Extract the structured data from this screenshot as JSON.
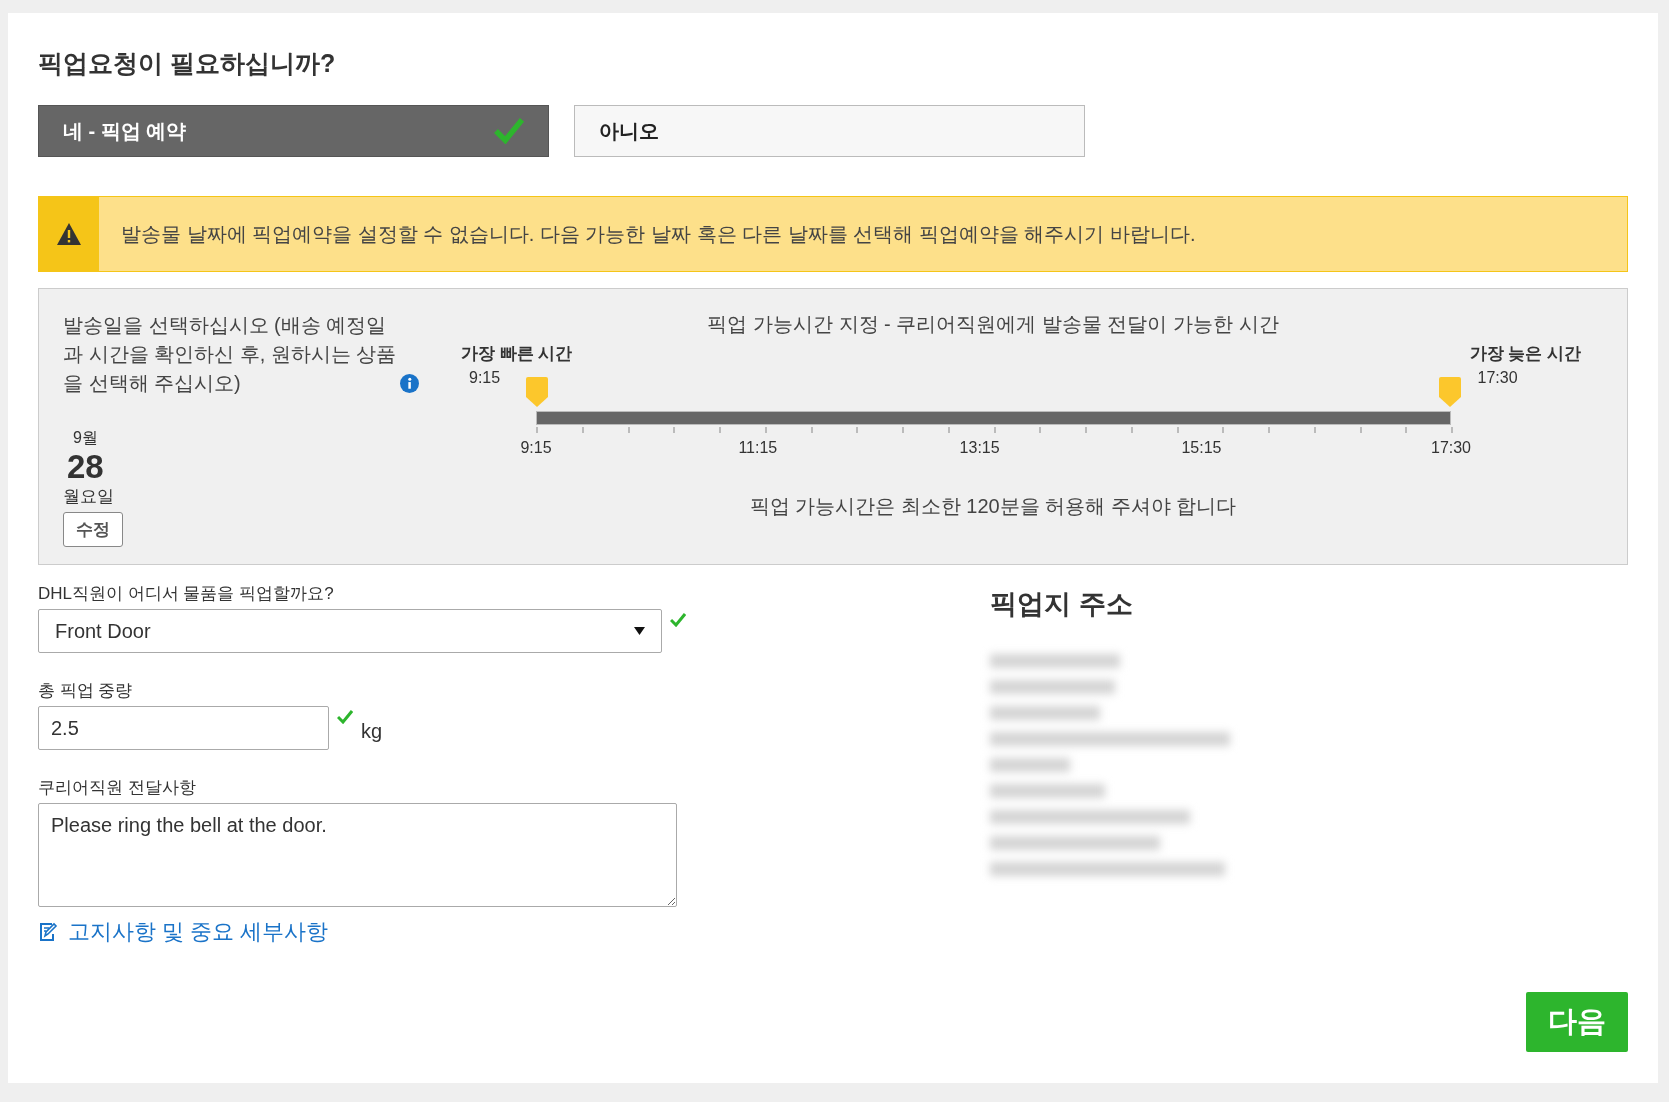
{
  "title": "픽업요청이 필요하십니까?",
  "choices": [
    {
      "label": "네 - 픽업 예약",
      "selected": true
    },
    {
      "label": "아니오",
      "selected": false
    }
  ],
  "warning": "발송물 날짜에 픽업예약을 설정할 수 없습니다. 다음 가능한 날짜 혹은 다른 날짜를 선택해 픽업예약을 해주시기 바랍니다.",
  "schedule": {
    "instruction": "발송일을 선택하십시오 (배송 예정일과 시간을 확인하신 후, 원하시는 상품을 선택해 주십시오)",
    "date": {
      "month": "9월",
      "day": "28",
      "weekday": "월요일"
    },
    "edit_button": "수정",
    "heading": "픽업 가능시간 지정 - 쿠리어직원에게 발송물 전달이 가능한 시간",
    "earliest": {
      "label": "가장 빠른 시간",
      "time": "9:15",
      "level": 0
    },
    "latest": {
      "label": "가장 늦은 시간",
      "time": "17:30",
      "level": 1
    },
    "ticks": [
      "9:15",
      "11:15",
      "13:15",
      "15:15",
      "17:30"
    ],
    "note": "픽업 가능시간은 최소한 120분을 허용해 주셔야 합니다"
  },
  "location": {
    "label": "DHL직원이 어디서 물품을 픽업할까요?",
    "value": "Front Door",
    "valid": true
  },
  "weight": {
    "label": "총 픽업 중량",
    "value": "2.5",
    "unit": "kg",
    "valid": true
  },
  "message": {
    "label": "쿠리어직원 전달사항",
    "value": "Please ring the bell at the door."
  },
  "details_link": "고지사항 및 중요 세부사항",
  "address_heading": "픽업지 주소",
  "next_button": "다음"
}
